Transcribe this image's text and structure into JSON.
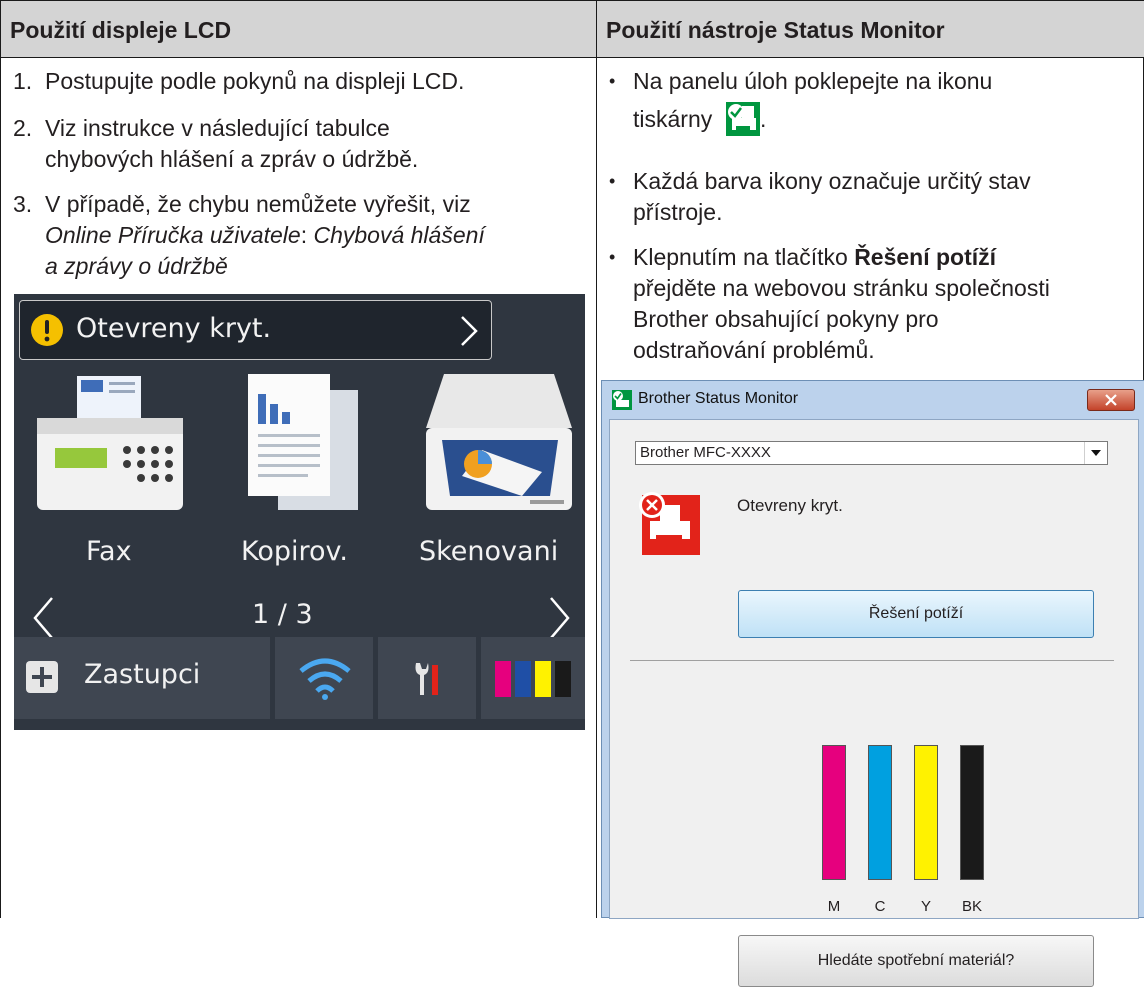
{
  "headers": {
    "left": "Použití displeje LCD",
    "right": "Použití nástroje Status Monitor"
  },
  "left_steps": [
    {
      "num": "1.",
      "lines": [
        "Postupujte podle pokynů na displeji LCD."
      ]
    },
    {
      "num": "2.",
      "lines": [
        "Viz instrukce v následující tabulce",
        "chybových hlášení a zpráv o údržbě."
      ]
    },
    {
      "num": "3.",
      "lines": [
        "V případě, že chybu nemůžete vyřešit, viz"
      ],
      "ref_part1": "Online Příručka uživatele",
      "ref_sep": ": ",
      "ref_part2": "Chybová hlášení",
      "ref_part3": "a zprávy o údržbě"
    }
  ],
  "right_bullets": {
    "b1_line1": "Na panelu úloh poklepejte na ikonu",
    "b1_line2": "tiskárny",
    "b1_end": ".",
    "b2_line1": "Každá barva ikony označuje určitý stav",
    "b2_line2": "přístroje.",
    "b3_line1_pre": "Klepnutím na tlačítko ",
    "b3_line1_bold": "Řešení potíží",
    "b3_line2": "přejděte na webovou stránku společnosti",
    "b3_line3": "Brother obsahující pokyny pro",
    "b3_line4": "odstraňování problémů."
  },
  "lcd": {
    "alert_text": "Otevreny kryt.",
    "apps": [
      "Fax",
      "Kopirov.",
      "Skenovani"
    ],
    "page": "1 / 3",
    "shortcuts_label": "Zastupci",
    "ink_colors": [
      "#1f4fa6",
      "#1a1a1a"
    ]
  },
  "status_window": {
    "title": "Brother Status Monitor",
    "device": "Brother MFC-XXXX",
    "status": "Otevreny kryt.",
    "troubleshoot_button": "Řešení potíží",
    "supplies_button": "Hledáte spotřební materiál?",
    "inks": [
      {
        "label": "M",
        "color": "#e6007e"
      },
      {
        "label": "C",
        "color": "#00a0e0"
      },
      {
        "label": "Y",
        "color": "#fff200"
      },
      {
        "label": "BK",
        "color": "#1a1a1a"
      }
    ],
    "error_color": "#e2231a"
  }
}
